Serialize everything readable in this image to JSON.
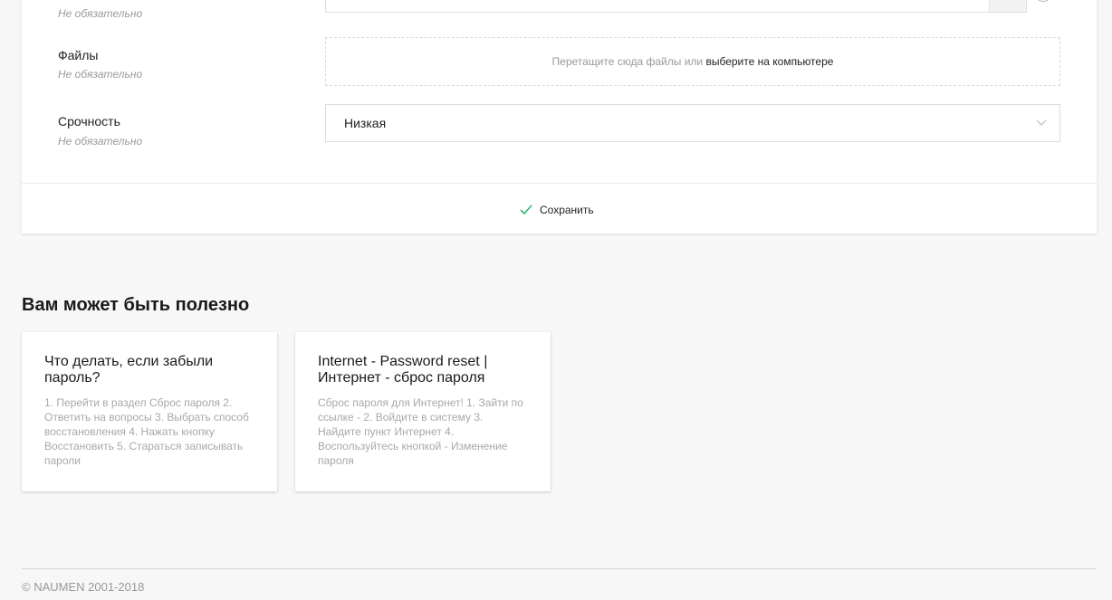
{
  "form": {
    "top_field": {
      "hint": "Не обязательно"
    },
    "files_field": {
      "label": "Файлы",
      "hint": "Не обязательно",
      "drop_text": "Перетащите сюда файлы или",
      "choose_link": "выберите на компьютере"
    },
    "urgency_field": {
      "label": "Срочность",
      "hint": "Не обязательно",
      "selected_value": "Низкая"
    },
    "save_label": "Сохранить"
  },
  "useful": {
    "title": "Вам может быть полезно",
    "articles": [
      {
        "title": "Что делать, если забыли пароль?",
        "text": "1. Перейти в раздел Сброс пароля 2. Ответить на вопросы 3. Выбрать способ восстановления 4. Нажать кнопку Восстановить 5. Стараться записывать пароли"
      },
      {
        "title": "Internet - Password reset | Интернет - сброс пароля",
        "text": "Сброс пароля для Интернет! 1. Зайти по ссылке - 2. Войдите в систему 3. Найдите пункт Интернет 4. Воспользуйтесь кнопкой - Изменение пароля"
      }
    ]
  },
  "footer": {
    "copyright": "© NAUMEN 2001-2018"
  },
  "colors": {
    "accent": "#2bb673",
    "background": "#f7f7f7",
    "card": "#ffffff"
  }
}
